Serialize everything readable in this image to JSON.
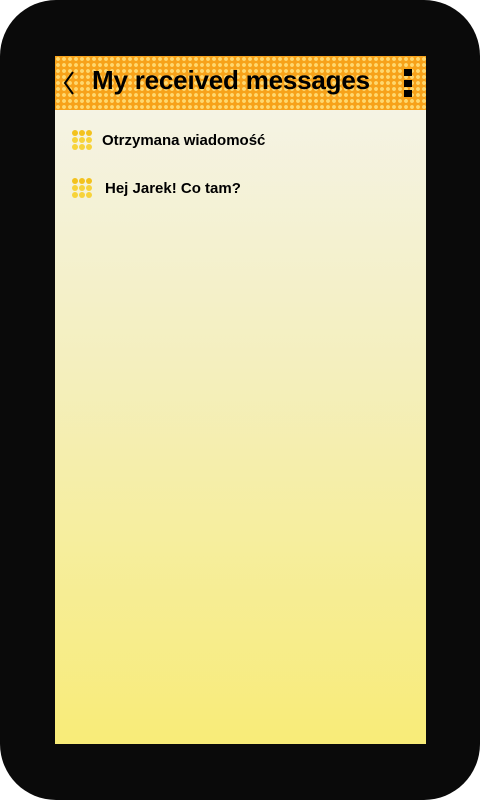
{
  "header": {
    "title": "My received messages",
    "back_icon": "chevron-left-icon",
    "menu_icon": "overflow-menu-icon"
  },
  "messages": [
    {
      "text": "Otrzymana wiadomość",
      "icon": "message-dots-icon"
    },
    {
      "text": "Hej Jarek! Co tam?",
      "icon": "message-dots-icon"
    }
  ],
  "colors": {
    "app_bar": "#f7a21a",
    "icon_dots": "#f7d33a",
    "screen_bottom": "#f8ec78",
    "frame": "#0a0a0a"
  }
}
